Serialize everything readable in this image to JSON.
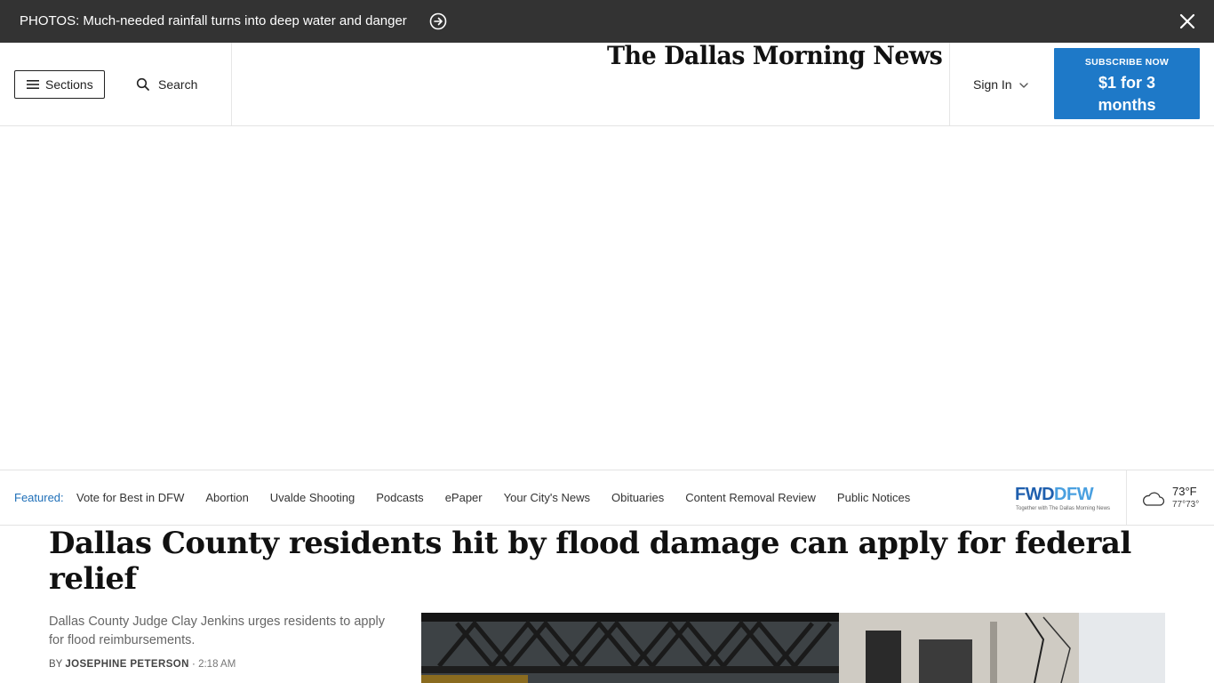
{
  "alert": {
    "text": "PHOTOS: Much-needed rainfall turns into deep water and danger"
  },
  "header": {
    "sections_label": "Sections",
    "search_label": "Search",
    "logo_text": "The Dallas Morning News",
    "signin_label": "Sign In",
    "subscribe_kicker": "SUBSCRIBE NOW",
    "subscribe_offer_line1": "$1 for 3",
    "subscribe_offer_line2": "months"
  },
  "featured": {
    "label": "Featured:",
    "links": [
      "Vote for Best in DFW",
      "Abortion",
      "Uvalde Shooting",
      "Podcasts",
      "ePaper",
      "Your City's News",
      "Obituaries",
      "Content Removal Review",
      "Public Notices"
    ],
    "fwd_logo_main": "FWD",
    "fwd_logo_dfw": "DFW",
    "fwd_logo_sub": "Together with The Dallas Morning News"
  },
  "weather": {
    "temp": "73°F",
    "range": "77°73°"
  },
  "article": {
    "headline": "Dallas County residents hit by flood damage can apply for federal relief",
    "dek": "Dallas County Judge Clay Jenkins urges residents to apply for flood reimbursements.",
    "byline_prefix": "BY",
    "author": "JOSEPHINE PETERSON",
    "separator": "·",
    "time": "2:18 AM"
  },
  "colors": {
    "alert_bg": "#333333",
    "accent_blue": "#1e79c8",
    "featured_blue": "#1e6fb8"
  }
}
